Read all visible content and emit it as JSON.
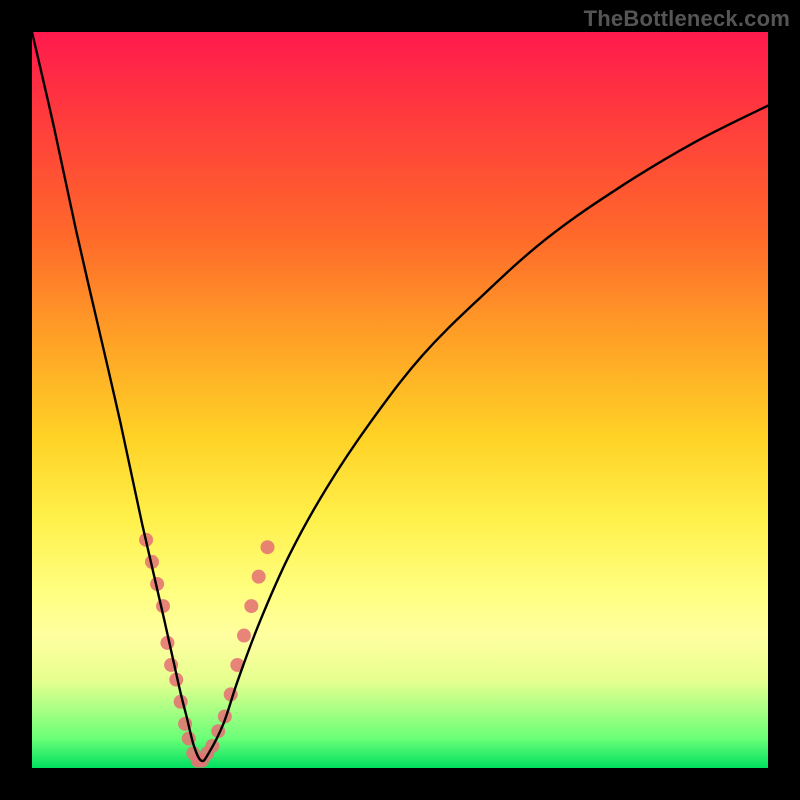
{
  "watermark": "TheBottleneck.com",
  "chart_data": {
    "type": "line",
    "title": "",
    "xlabel": "",
    "ylabel": "",
    "xlim": [
      0,
      100
    ],
    "ylim": [
      0,
      100
    ],
    "background_gradient": {
      "top_color": "#ff1a4d",
      "bottom_color": "#00e060",
      "description": "vertical rainbow gradient red→orange→yellow→green representing a value from 100 (red, bad) at top to 0 (green, good) at bottom"
    },
    "series": [
      {
        "name": "bottleneck-curve",
        "description": "V-shaped curve dipping to y≈0 near x≈23 and rising toward both sides",
        "color": "#000000",
        "x": [
          0,
          3,
          6,
          9,
          12,
          15,
          18,
          20,
          21,
          22,
          23,
          24,
          26,
          28,
          31,
          35,
          40,
          46,
          53,
          61,
          70,
          80,
          90,
          100
        ],
        "values": [
          100,
          87,
          73,
          60,
          47,
          33,
          20,
          11,
          7,
          3,
          1,
          2,
          6,
          12,
          20,
          29,
          38,
          47,
          56,
          64,
          72,
          79,
          85,
          90
        ]
      }
    ],
    "markers": {
      "name": "data-points",
      "description": "salmon-colored scatter markers clustered near the curve minimum",
      "color": "#e57373",
      "x": [
        15.5,
        16.3,
        17.0,
        17.8,
        18.4,
        18.9,
        19.6,
        20.2,
        20.8,
        21.3,
        21.9,
        22.5,
        23.1,
        23.8,
        24.5,
        25.3,
        26.2,
        27.0,
        27.9,
        28.8,
        29.8,
        30.8,
        32.0
      ],
      "values": [
        31,
        28,
        25,
        22,
        17,
        14,
        12,
        9,
        6,
        4,
        2,
        1,
        1,
        2,
        3,
        5,
        7,
        10,
        14,
        18,
        22,
        26,
        30
      ]
    }
  }
}
